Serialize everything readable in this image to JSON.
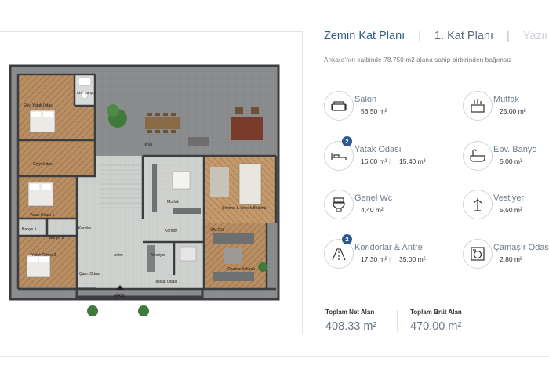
{
  "tabs": [
    {
      "label": "Zemin Kat Planı",
      "state": "active"
    },
    {
      "label": "1. Kat Planı",
      "state": "inactive"
    },
    {
      "label": "Yaziı",
      "state": "faded"
    }
  ],
  "description": "Ankara'nın kalbinde 78.750 m2 alana sahip birbirinden bağımsız",
  "rooms": [
    {
      "name": "Salon",
      "value": "56,50 m²",
      "icon": "sofa-icon"
    },
    {
      "name": "Mutfak",
      "value": "25,00 m²",
      "icon": "kitchen-icon"
    },
    {
      "name": "Yatak Odası",
      "value": "16,00 m²",
      "value2": "15,40 m²",
      "count": "2",
      "icon": "bed-icon"
    },
    {
      "name": "Ebv. Banyo",
      "value": "5,00 m²",
      "icon": "bathtub-icon"
    },
    {
      "name": "Genel Wc",
      "value": "4,40 m²",
      "icon": "toilet-icon"
    },
    {
      "name": "Vestiyer",
      "value": "5,50 m²",
      "icon": "coat-rack-icon"
    },
    {
      "name": "Koridorlar & Antre",
      "value": "17,30 m²",
      "value2": "35,00 m²",
      "count": "2",
      "icon": "corridor-icon"
    },
    {
      "name": "Çamaşır Odası",
      "value": "2,80 m²",
      "icon": "washing-machine-icon"
    }
  ],
  "totals": {
    "net_label": "Toplam Net Alan",
    "net_value": "408.33 m²",
    "gross_label": "Toplam Brüt Alan",
    "gross_value": "470,00 m²"
  },
  "plan": {
    "labels": {
      "ebv_yatak": "Ebv. Yatak Odası",
      "ebv_banyo": "Ebv. Banyo",
      "giyinme": "Giyyi Odası",
      "teras": "Teras",
      "yatak1": "Yatak Odası 1",
      "mutfak": "Mutfak",
      "somine": "Şömine & Yemek Bölümü",
      "banyo1": "Banyo 1",
      "banyo2": "Banyo 2",
      "koridor1": "Koridor",
      "koridor2": "Koridor",
      "salon": "SALON",
      "yatak2": "Yatak Odası 2",
      "antre": "Antre",
      "vestiyer": "Vestiyer",
      "cam": "Çam. Odası",
      "tesisat": "Tesisat Odası",
      "oturma": "Oturma Bölümü",
      "giris": "GİRİŞ"
    }
  },
  "colors": {
    "accent": "#2f5d8a",
    "badge": "#2c5a94",
    "wall": "#3b3d40",
    "wood": "#b98e63",
    "tile": "#c9cbc8"
  }
}
